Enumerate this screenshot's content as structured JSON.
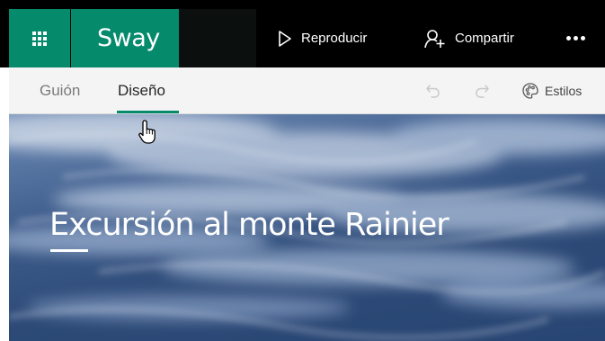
{
  "app": {
    "name": "Sway",
    "brand_color": "#058a6c"
  },
  "topbar": {
    "play_label": "Reproducir",
    "share_label": "Compartir",
    "more_icon": "more-ellipsis-icon"
  },
  "tabs": [
    {
      "label": "Guión",
      "active": false
    },
    {
      "label": "Diseño",
      "active": true
    }
  ],
  "toolbar": {
    "undo_icon": "undo-icon",
    "redo_icon": "redo-icon",
    "styles_label": "Estilos",
    "styles_icon": "palette-icon"
  },
  "canvas": {
    "title": "Excursión al monte Rainier",
    "background": "sky-with-clouds"
  }
}
